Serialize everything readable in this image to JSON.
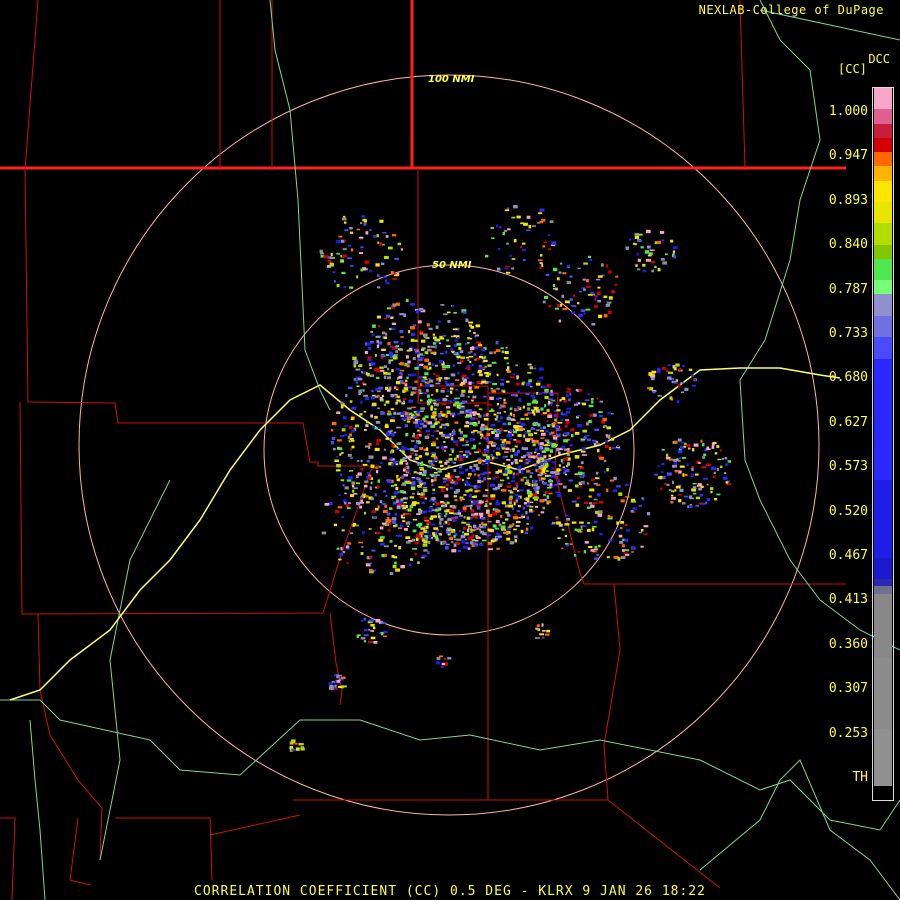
{
  "header": {
    "credit": "NEXLAB-College of DuPage",
    "site_code": "DCC",
    "units": "[CC]"
  },
  "footer": {
    "caption": "CORRELATION COEFFICIENT (CC) 0.5 DEG - KLRX 9 JAN 26 18:22"
  },
  "range_rings": {
    "inner_label": "50 NMI",
    "outer_label": "100 NMI"
  },
  "colorbar": {
    "ticks": [
      "1.000",
      "0.947",
      "0.893",
      "0.840",
      "0.787",
      "0.733",
      "0.680",
      "0.627",
      "0.573",
      "0.520",
      "0.467",
      "0.413",
      "0.360",
      "0.307",
      "0.253",
      "TH"
    ],
    "colors": [
      "#f7a6c8",
      "#e06090",
      "#c81e3c",
      "#d40000",
      "#ff6a00",
      "#ffb400",
      "#ffe600",
      "#e6e600",
      "#b4dc00",
      "#82c800",
      "#50e650",
      "#78ff78",
      "#9090d0",
      "#7070e0",
      "#4a4aff",
      "#2828ff",
      "#1e1ee6",
      "#1a1acc",
      "#2a2ab0",
      "#707090",
      "#888888",
      "#8c8c8c",
      "#909090",
      "#000000"
    ],
    "color_stops": [
      0,
      3,
      5,
      7,
      9,
      11,
      13,
      16,
      19,
      22,
      24,
      27,
      29,
      32,
      35,
      38,
      55,
      66,
      69,
      70,
      71,
      80,
      90,
      98,
      100
    ]
  },
  "colors": {
    "state_borders": "#ff2020",
    "county_borders": "#cc1010",
    "highways": "#ffff66",
    "terrain": "#7fd49a",
    "rings": "#ffb0b0",
    "label": "#ffff44"
  }
}
